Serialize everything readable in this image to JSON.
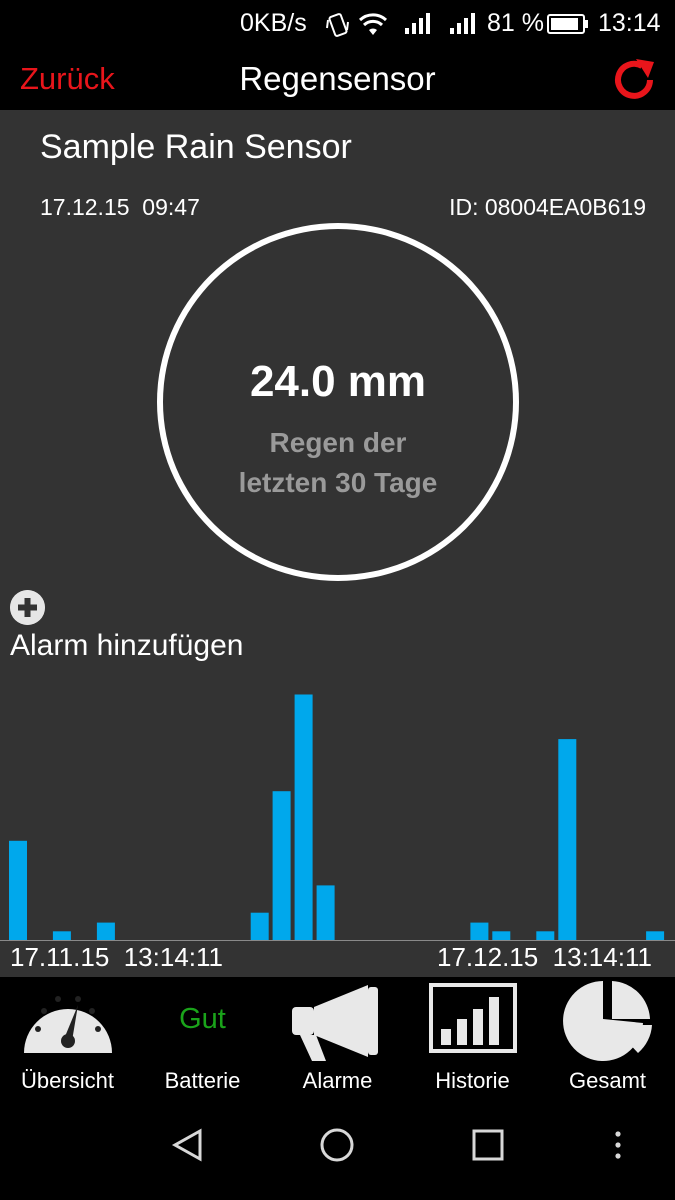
{
  "status_bar": {
    "net_speed": "0KB/s",
    "battery_percent": "81 %",
    "time": "13:14",
    "icons": [
      "vibrate-icon",
      "wifi-icon",
      "signal-icon",
      "signal-icon",
      "battery-icon"
    ]
  },
  "app_bar": {
    "back_label": "Zurück",
    "title": "Regensensor",
    "refresh_icon": "refresh-icon"
  },
  "sensor": {
    "name": "Sample Rain Sensor",
    "timestamp": "17.12.15  09:47",
    "id_label": "ID: 08004EA0B619"
  },
  "gauge": {
    "value": "24.0 mm",
    "caption_line1": "Regen der",
    "caption_line2": "letzten 30 Tage"
  },
  "alarm": {
    "add_label": "Alarm hinzufügen",
    "icon": "plus-circle-icon"
  },
  "chart_data": {
    "type": "bar",
    "title": "",
    "xlabel": "",
    "ylabel": "",
    "x_start_label": "17.11.15  13:14:11",
    "x_end_label": "17.12.15  13:14:11",
    "bar_color": "#00a8ec",
    "ylim": [
      0,
      10
    ],
    "values": [
      4.0,
      0,
      0.35,
      0,
      0.7,
      0,
      0,
      0,
      0,
      0,
      0,
      1.1,
      6.0,
      9.9,
      2.2,
      0,
      0,
      0,
      0,
      0,
      0,
      0.7,
      0.35,
      0,
      0.35,
      8.1,
      0,
      0,
      0,
      0.35
    ]
  },
  "bottom_nav": {
    "items": [
      {
        "label": "Übersicht",
        "icon": "speedometer-icon"
      },
      {
        "label": "Batterie",
        "icon": "battery-status-text",
        "status": "Gut"
      },
      {
        "label": "Alarme",
        "icon": "megaphone-icon"
      },
      {
        "label": "Historie",
        "icon": "bar-chart-icon"
      },
      {
        "label": "Gesamt",
        "icon": "pie-chart-icon"
      }
    ]
  },
  "system_nav": {
    "icons": [
      "back-triangle-icon",
      "home-circle-icon",
      "recents-square-icon",
      "more-dots-icon"
    ]
  },
  "colors": {
    "accent_red": "#e8151b",
    "content_bg": "#333333",
    "battery_ok": "#1aa31a",
    "gauge_caption": "#9a9a9a"
  }
}
